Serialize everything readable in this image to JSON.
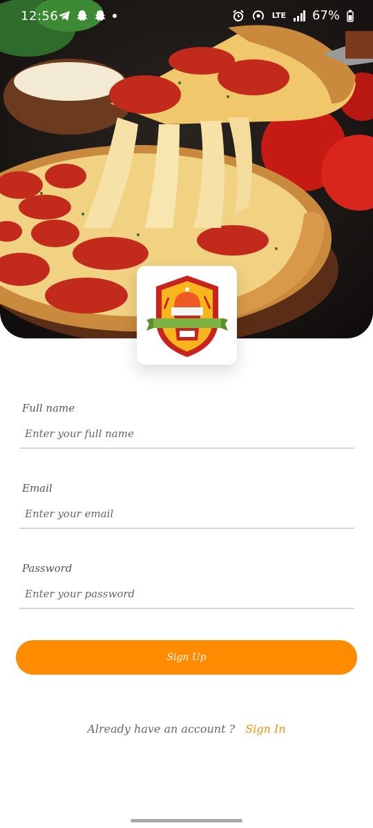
{
  "status_bar": {
    "time": "12:56",
    "network": "LTE",
    "battery": "67%",
    "icons": [
      "telegram-icon",
      "snapchat-icon",
      "snapchat-icon",
      "dot-icon",
      "alarm-icon",
      "hotspot-icon",
      "lte-icon",
      "signal-icon",
      "battery-icon"
    ]
  },
  "hero": {
    "image": "pizza-hero-image",
    "logo": "restaurant-crest-logo"
  },
  "form": {
    "full_name": {
      "label": "Full name",
      "placeholder": "Enter your full name"
    },
    "email": {
      "label": "Email",
      "placeholder": "Enter your email"
    },
    "password": {
      "label": "Password",
      "placeholder": "Enter your password"
    }
  },
  "actions": {
    "signup_label": "Sign Up",
    "signin_prompt": "Already have an account ?",
    "signin_link": "Sign In"
  },
  "colors": {
    "accent": "#ff8c00",
    "logo_red": "#c8231f",
    "logo_green": "#7cb342",
    "logo_yellow": "#f6b61c"
  }
}
